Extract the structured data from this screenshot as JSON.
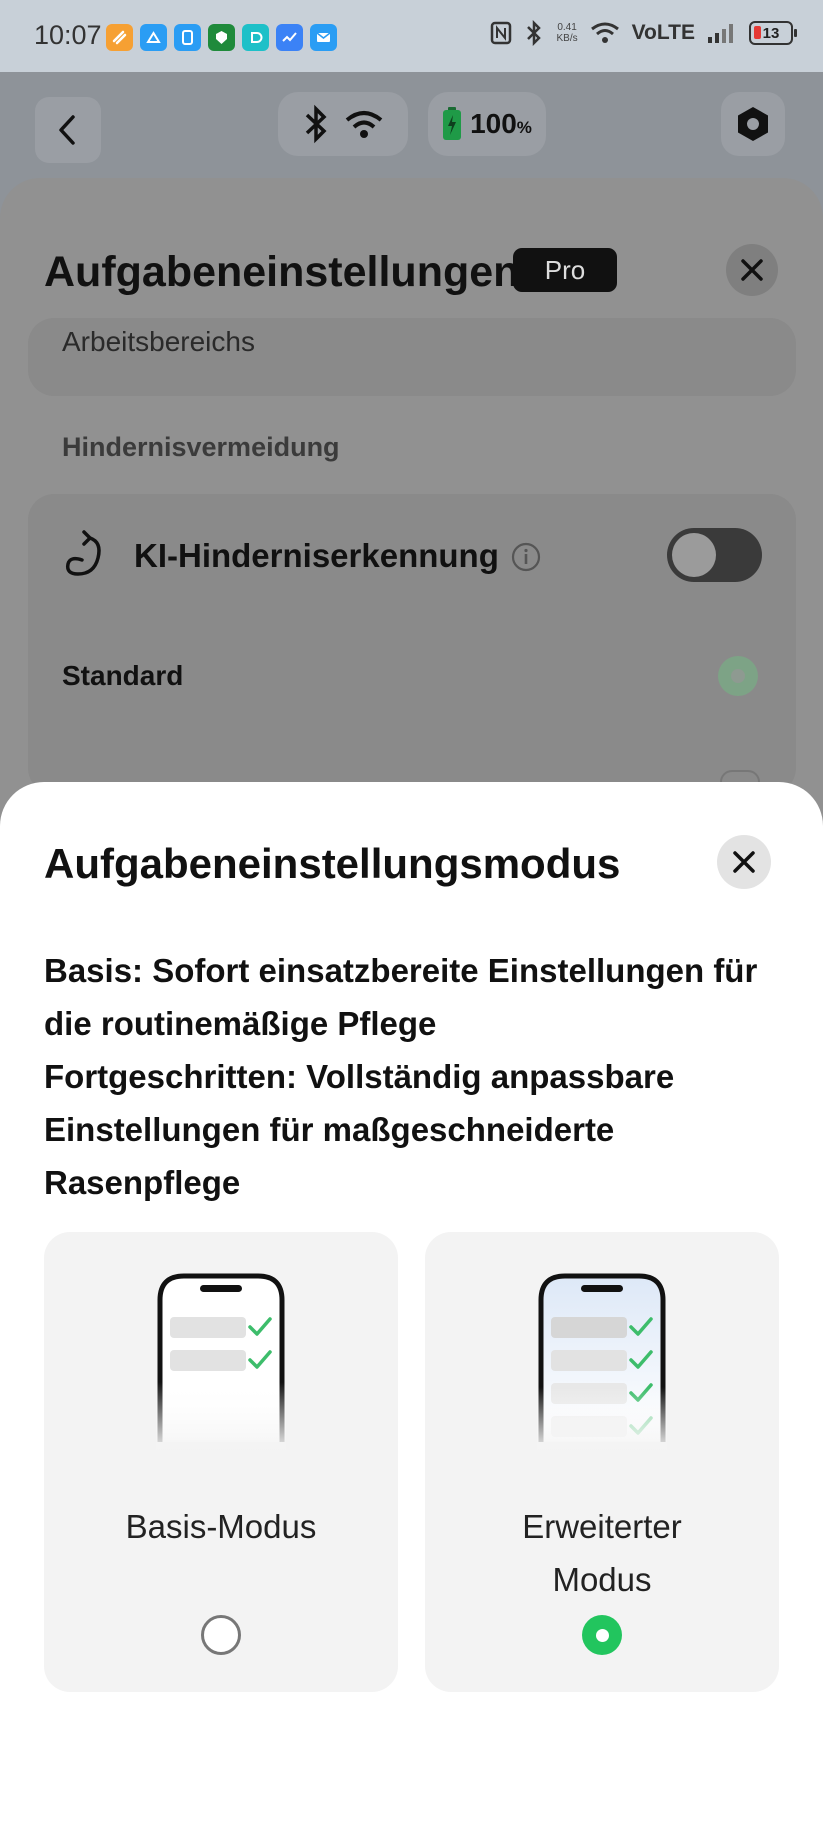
{
  "status_bar": {
    "time": "10:07",
    "net_speed_value": "0.41",
    "net_speed_unit": "KB/s",
    "volte": "VoLTE",
    "battery": "13"
  },
  "app": {
    "pill_battery": "100",
    "pill_battery_unit": "%",
    "sheet_title": "Aufgabeneinstellungen",
    "pro_badge": "Pro",
    "partial_item": "Arbeitsbereichs",
    "section_label": "Hindernisvermeidung",
    "ki_label": "KI-Hinderniserkennung",
    "standard_label": "Standard"
  },
  "modal": {
    "title": "Aufgabeneinstellungsmodus",
    "description_lines": [
      "Basis: Sofort einsatzbereite Einstellungen für",
      "die routinemäßige Pflege",
      "Fortgeschritten: Vollständig anpassbare",
      "Einstellungen für maßgeschneiderte",
      "Rasenpflege"
    ],
    "options": [
      {
        "label": "Basis-Modus",
        "selected": false
      },
      {
        "label_lines": [
          "Erweiterter",
          "Modus"
        ],
        "selected": true
      }
    ]
  },
  "colors": {
    "accent_green": "#22c55e",
    "check_green": "#3dbd6b"
  }
}
